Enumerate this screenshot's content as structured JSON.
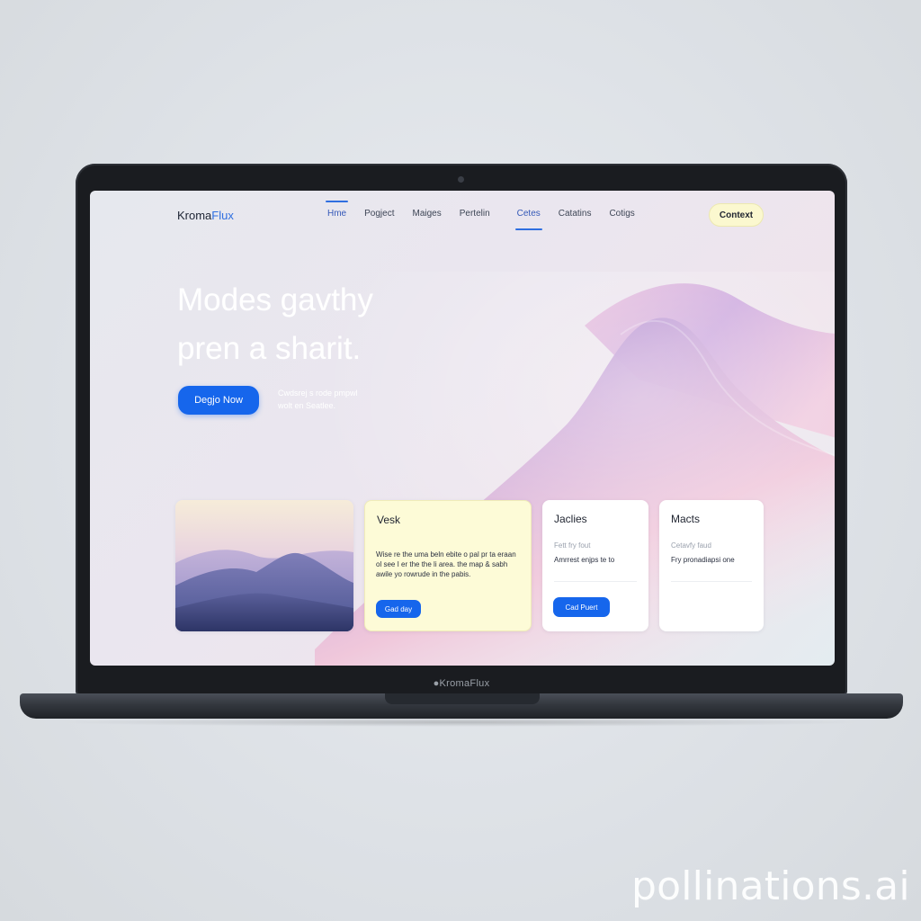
{
  "brand": {
    "name_main": "Kroma",
    "name_accent": "Flux",
    "bezel_label": "●KromaFlux"
  },
  "nav": {
    "items": [
      {
        "label": "Hme",
        "active": true
      },
      {
        "label": "Pogject",
        "active": false
      },
      {
        "label": "Maiges",
        "active": false
      },
      {
        "label": "Pertelin",
        "active": false
      },
      {
        "label": "Cetes",
        "active": true
      },
      {
        "label": "Catatins",
        "active": false
      },
      {
        "label": "Cotigs",
        "active": false
      }
    ],
    "contact_label": "Context"
  },
  "hero": {
    "title_line1": "Modes gavthy",
    "title_line2": "pren a sharit.",
    "cta_label": "Degjo Now",
    "sub_line1": "Cwdsrej s rode pmpwl",
    "sub_line2": "wolt en Seatlee."
  },
  "cards": {
    "yellow": {
      "title": "Vesk",
      "text": "Wise re the uma beln ebite o pal pr ta eraan ol see I er the the li area. the map & sabh awile yo rowrude in the pabis.",
      "button": "Gad day"
    },
    "white1": {
      "title": "Jaclies",
      "meta": "Fett fry fout",
      "text": "Amrrest enjps te to",
      "button": "Cad Puert"
    },
    "white2": {
      "title": "Macts",
      "meta": "Cetavfy faud",
      "text": "Fry pronadiapsi one"
    }
  },
  "watermark": "pollinations.ai",
  "colors": {
    "accent": "#1666ec",
    "contact_bg": "#fbf8cf",
    "yellow_card": "#fdfbd7",
    "laptop": "#1a1c20"
  }
}
